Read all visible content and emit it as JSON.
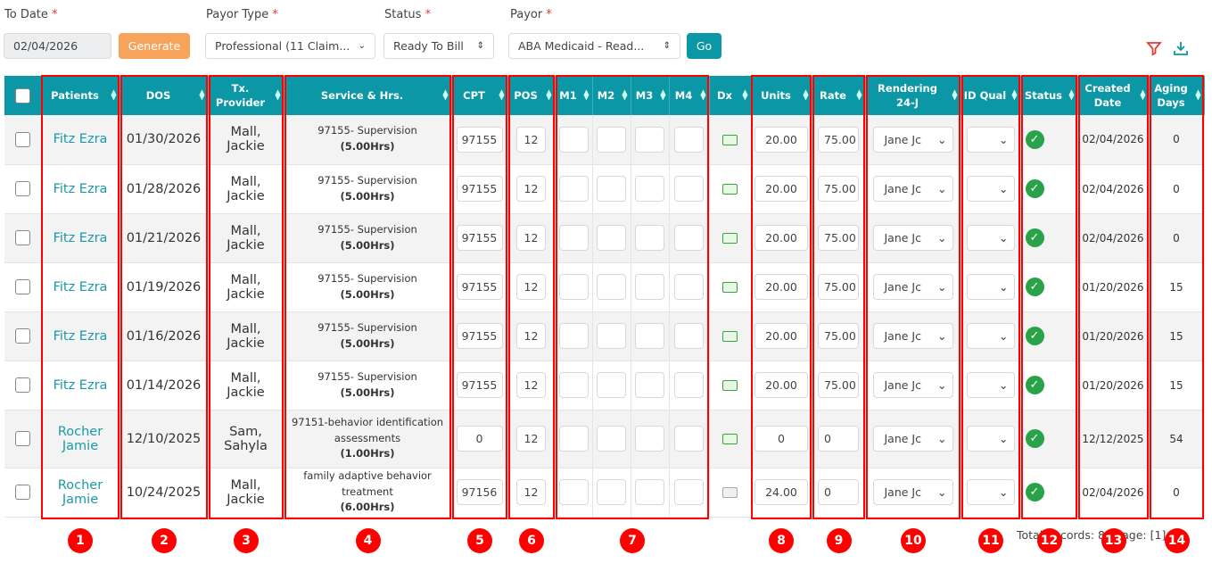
{
  "filters": {
    "to_date_label": "To Date",
    "to_date_value": "02/04/2026",
    "generate_label": "Generate",
    "payor_type_label": "Payor Type",
    "payor_type_value": "Professional (11 Claim...",
    "status_label": "Status",
    "status_value": "Ready To Bill",
    "payor_label": "Payor",
    "payor_value": "ABA Medicaid - Read...",
    "go_label": "Go",
    "required_mark": "*"
  },
  "toolbar": {
    "filter_icon": "filter-icon",
    "download_icon": "download-icon"
  },
  "columns": [
    "Patients",
    "DOS",
    "Tx. Provider",
    "Service & Hrs.",
    "CPT",
    "POS",
    "M1",
    "M2",
    "M3",
    "M4",
    "Dx",
    "Units",
    "Rate",
    "Rendering 24-J",
    "ID Qual",
    "Status",
    "Created Date",
    "Aging Days"
  ],
  "rows": [
    {
      "patient": "Fitz Ezra",
      "dos": "01/30/2026",
      "provider": "Mall, Jackie",
      "service": "97155- Supervision",
      "hrs": "(5.00Hrs)",
      "cpt": "97155",
      "pos": "12",
      "units": "20.00",
      "rate": "75.00",
      "rendering": "Jane Jc",
      "created": "02/04/2026",
      "aging": "0",
      "dx": "green"
    },
    {
      "patient": "Fitz Ezra",
      "dos": "01/28/2026",
      "provider": "Mall, Jackie",
      "service": "97155- Supervision",
      "hrs": "(5.00Hrs)",
      "cpt": "97155",
      "pos": "12",
      "units": "20.00",
      "rate": "75.00",
      "rendering": "Jane Jc",
      "created": "02/04/2026",
      "aging": "0",
      "dx": "green"
    },
    {
      "patient": "Fitz Ezra",
      "dos": "01/21/2026",
      "provider": "Mall, Jackie",
      "service": "97155- Supervision",
      "hrs": "(5.00Hrs)",
      "cpt": "97155",
      "pos": "12",
      "units": "20.00",
      "rate": "75.00",
      "rendering": "Jane Jc",
      "created": "02/04/2026",
      "aging": "0",
      "dx": "green"
    },
    {
      "patient": "Fitz Ezra",
      "dos": "01/19/2026",
      "provider": "Mall, Jackie",
      "service": "97155- Supervision",
      "hrs": "(5.00Hrs)",
      "cpt": "97155",
      "pos": "12",
      "units": "20.00",
      "rate": "75.00",
      "rendering": "Jane Jc",
      "created": "01/20/2026",
      "aging": "15",
      "dx": "green"
    },
    {
      "patient": "Fitz Ezra",
      "dos": "01/16/2026",
      "provider": "Mall, Jackie",
      "service": "97155- Supervision",
      "hrs": "(5.00Hrs)",
      "cpt": "97155",
      "pos": "12",
      "units": "20.00",
      "rate": "75.00",
      "rendering": "Jane Jc",
      "created": "01/20/2026",
      "aging": "15",
      "dx": "green"
    },
    {
      "patient": "Fitz Ezra",
      "dos": "01/14/2026",
      "provider": "Mall, Jackie",
      "service": "97155- Supervision",
      "hrs": "(5.00Hrs)",
      "cpt": "97155",
      "pos": "12",
      "units": "20.00",
      "rate": "75.00",
      "rendering": "Jane Jc",
      "created": "01/20/2026",
      "aging": "15",
      "dx": "green"
    },
    {
      "patient": "Rocher Jamie",
      "dos": "12/10/2025",
      "provider": "Sam, Sahyla",
      "service": "97151-behavior identification assessments",
      "hrs": "(1.00Hrs)",
      "cpt": "0",
      "pos": "12",
      "units": "0",
      "rate": "0",
      "rendering": "Jane Jc",
      "created": "12/12/2025",
      "aging": "54",
      "dx": "green"
    },
    {
      "patient": "Rocher Jamie",
      "dos": "10/24/2025",
      "provider": "Mall, Jackie",
      "service": "family adaptive behavior treatment",
      "hrs": "(6.00Hrs)",
      "cpt": "97156",
      "pos": "12",
      "units": "24.00",
      "rate": "0",
      "rendering": "Jane Jc",
      "created": "02/04/2026",
      "aging": "0",
      "dx": "gray"
    }
  ],
  "footer": {
    "records": "Total Records: 8 | Page: [1]"
  },
  "annotations": [
    "1",
    "2",
    "3",
    "4",
    "5",
    "6",
    "7",
    "8",
    "9",
    "10",
    "11",
    "12",
    "13",
    "14"
  ],
  "colors": {
    "header": "#0b97a5",
    "accent": "#1a9aa8",
    "generate": "#f7a35c",
    "annotation": "#ff0000"
  }
}
